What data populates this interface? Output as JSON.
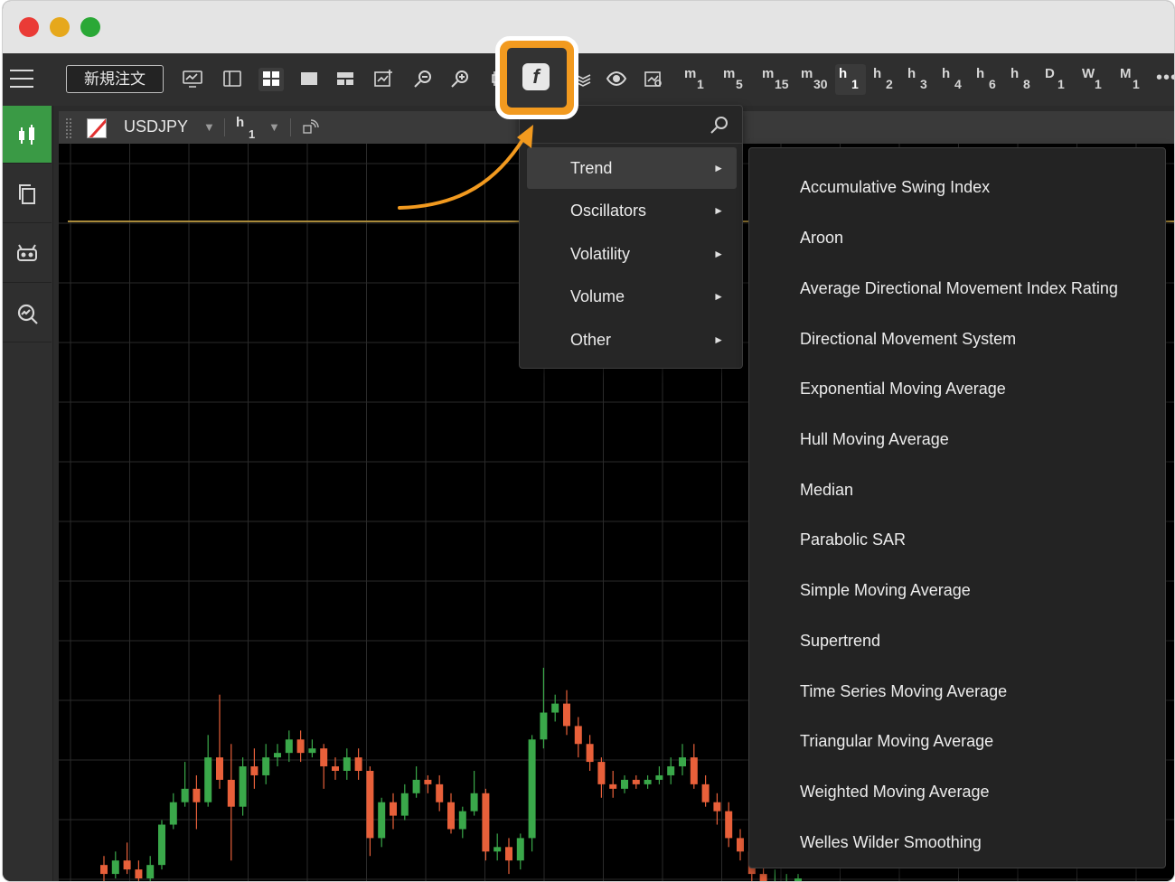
{
  "toolbar": {
    "new_order_label": "新規注文",
    "timeframes": [
      {
        "letter": "m",
        "num": "1"
      },
      {
        "letter": "m",
        "num": "5"
      },
      {
        "letter": "m",
        "num": "15"
      },
      {
        "letter": "m",
        "num": "30"
      },
      {
        "letter": "h",
        "num": "1"
      },
      {
        "letter": "h",
        "num": "2"
      },
      {
        "letter": "h",
        "num": "3"
      },
      {
        "letter": "h",
        "num": "4"
      },
      {
        "letter": "h",
        "num": "6"
      },
      {
        "letter": "h",
        "num": "8"
      },
      {
        "letter": "D",
        "num": "1"
      },
      {
        "letter": "W",
        "num": "1"
      },
      {
        "letter": "M",
        "num": "1"
      }
    ],
    "active_timeframe": "h1",
    "more_label": "•••"
  },
  "chart_header": {
    "symbol": "USDJPY",
    "timeframe_letter": "h",
    "timeframe_num": "1"
  },
  "indicator_menu": {
    "categories": [
      {
        "label": "Trend",
        "arrow": "►"
      },
      {
        "label": "Oscillators",
        "arrow": "►"
      },
      {
        "label": "Volatility",
        "arrow": "►"
      },
      {
        "label": "Volume",
        "arrow": "►"
      },
      {
        "label": "Other",
        "arrow": "►"
      }
    ],
    "highlighted": "Trend"
  },
  "trend_submenu": {
    "items": [
      "Accumulative Swing Index",
      "Aroon",
      "Average Directional Movement Index Rating",
      "Directional Movement System",
      "Exponential Moving Average",
      "Hull Moving Average",
      "Median",
      "Parabolic SAR",
      "Simple Moving Average",
      "Supertrend",
      "Time Series Moving Average",
      "Triangular Moving Average",
      "Weighted Moving Average",
      "Welles Wilder Smoothing"
    ]
  },
  "colors": {
    "highlight_orange": "#f29a1f",
    "candle_up": "#3aa84a",
    "candle_down": "#e8603a",
    "active_sidebar": "#3a9a45"
  },
  "candles": [
    {
      "o": 0.04,
      "c": 0.02,
      "h": 0.06,
      "l": 0.0
    },
    {
      "o": 0.02,
      "c": 0.05,
      "h": 0.07,
      "l": 0.01
    },
    {
      "o": 0.05,
      "c": 0.03,
      "h": 0.09,
      "l": 0.02
    },
    {
      "o": 0.03,
      "c": 0.01,
      "h": 0.05,
      "l": 0.0
    },
    {
      "o": 0.01,
      "c": 0.04,
      "h": 0.06,
      "l": 0.0
    },
    {
      "o": 0.04,
      "c": 0.13,
      "h": 0.14,
      "l": 0.03
    },
    {
      "o": 0.13,
      "c": 0.18,
      "h": 0.2,
      "l": 0.12
    },
    {
      "o": 0.18,
      "c": 0.21,
      "h": 0.27,
      "l": 0.17
    },
    {
      "o": 0.21,
      "c": 0.18,
      "h": 0.24,
      "l": 0.12
    },
    {
      "o": 0.18,
      "c": 0.28,
      "h": 0.33,
      "l": 0.17
    },
    {
      "o": 0.28,
      "c": 0.23,
      "h": 0.42,
      "l": 0.21
    },
    {
      "o": 0.23,
      "c": 0.17,
      "h": 0.31,
      "l": 0.05
    },
    {
      "o": 0.17,
      "c": 0.26,
      "h": 0.28,
      "l": 0.15
    },
    {
      "o": 0.26,
      "c": 0.24,
      "h": 0.3,
      "l": 0.21
    },
    {
      "o": 0.24,
      "c": 0.28,
      "h": 0.31,
      "l": 0.22
    },
    {
      "o": 0.28,
      "c": 0.29,
      "h": 0.31,
      "l": 0.26
    },
    {
      "o": 0.29,
      "c": 0.32,
      "h": 0.34,
      "l": 0.27
    },
    {
      "o": 0.32,
      "c": 0.29,
      "h": 0.34,
      "l": 0.27
    },
    {
      "o": 0.29,
      "c": 0.3,
      "h": 0.32,
      "l": 0.28
    },
    {
      "o": 0.3,
      "c": 0.26,
      "h": 0.31,
      "l": 0.21
    },
    {
      "o": 0.26,
      "c": 0.25,
      "h": 0.28,
      "l": 0.23
    },
    {
      "o": 0.25,
      "c": 0.28,
      "h": 0.3,
      "l": 0.23
    },
    {
      "o": 0.28,
      "c": 0.25,
      "h": 0.3,
      "l": 0.23
    },
    {
      "o": 0.25,
      "c": 0.1,
      "h": 0.26,
      "l": 0.06
    },
    {
      "o": 0.1,
      "c": 0.18,
      "h": 0.19,
      "l": 0.08
    },
    {
      "o": 0.18,
      "c": 0.15,
      "h": 0.2,
      "l": 0.12
    },
    {
      "o": 0.15,
      "c": 0.2,
      "h": 0.22,
      "l": 0.14
    },
    {
      "o": 0.2,
      "c": 0.23,
      "h": 0.26,
      "l": 0.19
    },
    {
      "o": 0.23,
      "c": 0.22,
      "h": 0.24,
      "l": 0.2
    },
    {
      "o": 0.22,
      "c": 0.18,
      "h": 0.24,
      "l": 0.16
    },
    {
      "o": 0.18,
      "c": 0.12,
      "h": 0.2,
      "l": 0.11
    },
    {
      "o": 0.12,
      "c": 0.16,
      "h": 0.17,
      "l": 0.1
    },
    {
      "o": 0.16,
      "c": 0.2,
      "h": 0.25,
      "l": 0.15
    },
    {
      "o": 0.2,
      "c": 0.07,
      "h": 0.21,
      "l": 0.05
    },
    {
      "o": 0.07,
      "c": 0.08,
      "h": 0.11,
      "l": 0.05
    },
    {
      "o": 0.08,
      "c": 0.05,
      "h": 0.1,
      "l": 0.02
    },
    {
      "o": 0.05,
      "c": 0.1,
      "h": 0.11,
      "l": 0.03
    },
    {
      "o": 0.1,
      "c": 0.32,
      "h": 0.33,
      "l": 0.07
    },
    {
      "o": 0.32,
      "c": 0.38,
      "h": 0.48,
      "l": 0.3
    },
    {
      "o": 0.38,
      "c": 0.4,
      "h": 0.42,
      "l": 0.36
    },
    {
      "o": 0.4,
      "c": 0.35,
      "h": 0.43,
      "l": 0.33
    },
    {
      "o": 0.35,
      "c": 0.31,
      "h": 0.37,
      "l": 0.28
    },
    {
      "o": 0.31,
      "c": 0.27,
      "h": 0.33,
      "l": 0.25
    },
    {
      "o": 0.27,
      "c": 0.22,
      "h": 0.28,
      "l": 0.19
    },
    {
      "o": 0.22,
      "c": 0.21,
      "h": 0.25,
      "l": 0.19
    },
    {
      "o": 0.21,
      "c": 0.23,
      "h": 0.24,
      "l": 0.2
    },
    {
      "o": 0.23,
      "c": 0.22,
      "h": 0.24,
      "l": 0.21
    },
    {
      "o": 0.22,
      "c": 0.23,
      "h": 0.24,
      "l": 0.21
    },
    {
      "o": 0.23,
      "c": 0.24,
      "h": 0.26,
      "l": 0.22
    },
    {
      "o": 0.24,
      "c": 0.26,
      "h": 0.28,
      "l": 0.22
    },
    {
      "o": 0.26,
      "c": 0.28,
      "h": 0.31,
      "l": 0.24
    },
    {
      "o": 0.28,
      "c": 0.22,
      "h": 0.31,
      "l": 0.21
    },
    {
      "o": 0.22,
      "c": 0.18,
      "h": 0.24,
      "l": 0.17
    },
    {
      "o": 0.18,
      "c": 0.16,
      "h": 0.2,
      "l": 0.13
    },
    {
      "o": 0.16,
      "c": 0.1,
      "h": 0.18,
      "l": 0.08
    },
    {
      "o": 0.1,
      "c": 0.07,
      "h": 0.12,
      "l": 0.05
    },
    {
      "o": 0.07,
      "c": 0.02,
      "h": 0.09,
      "l": 0.0
    },
    {
      "o": 0.02,
      "c": 0.0,
      "h": 0.05,
      "l": 0.0
    },
    {
      "o": 0.0,
      "c": 0.0,
      "h": 0.03,
      "l": 0.0
    },
    {
      "o": 0.0,
      "c": 0.0,
      "h": 0.02,
      "l": 0.0
    },
    {
      "o": 0.0,
      "c": 0.01,
      "h": 0.02,
      "l": 0.0
    }
  ]
}
